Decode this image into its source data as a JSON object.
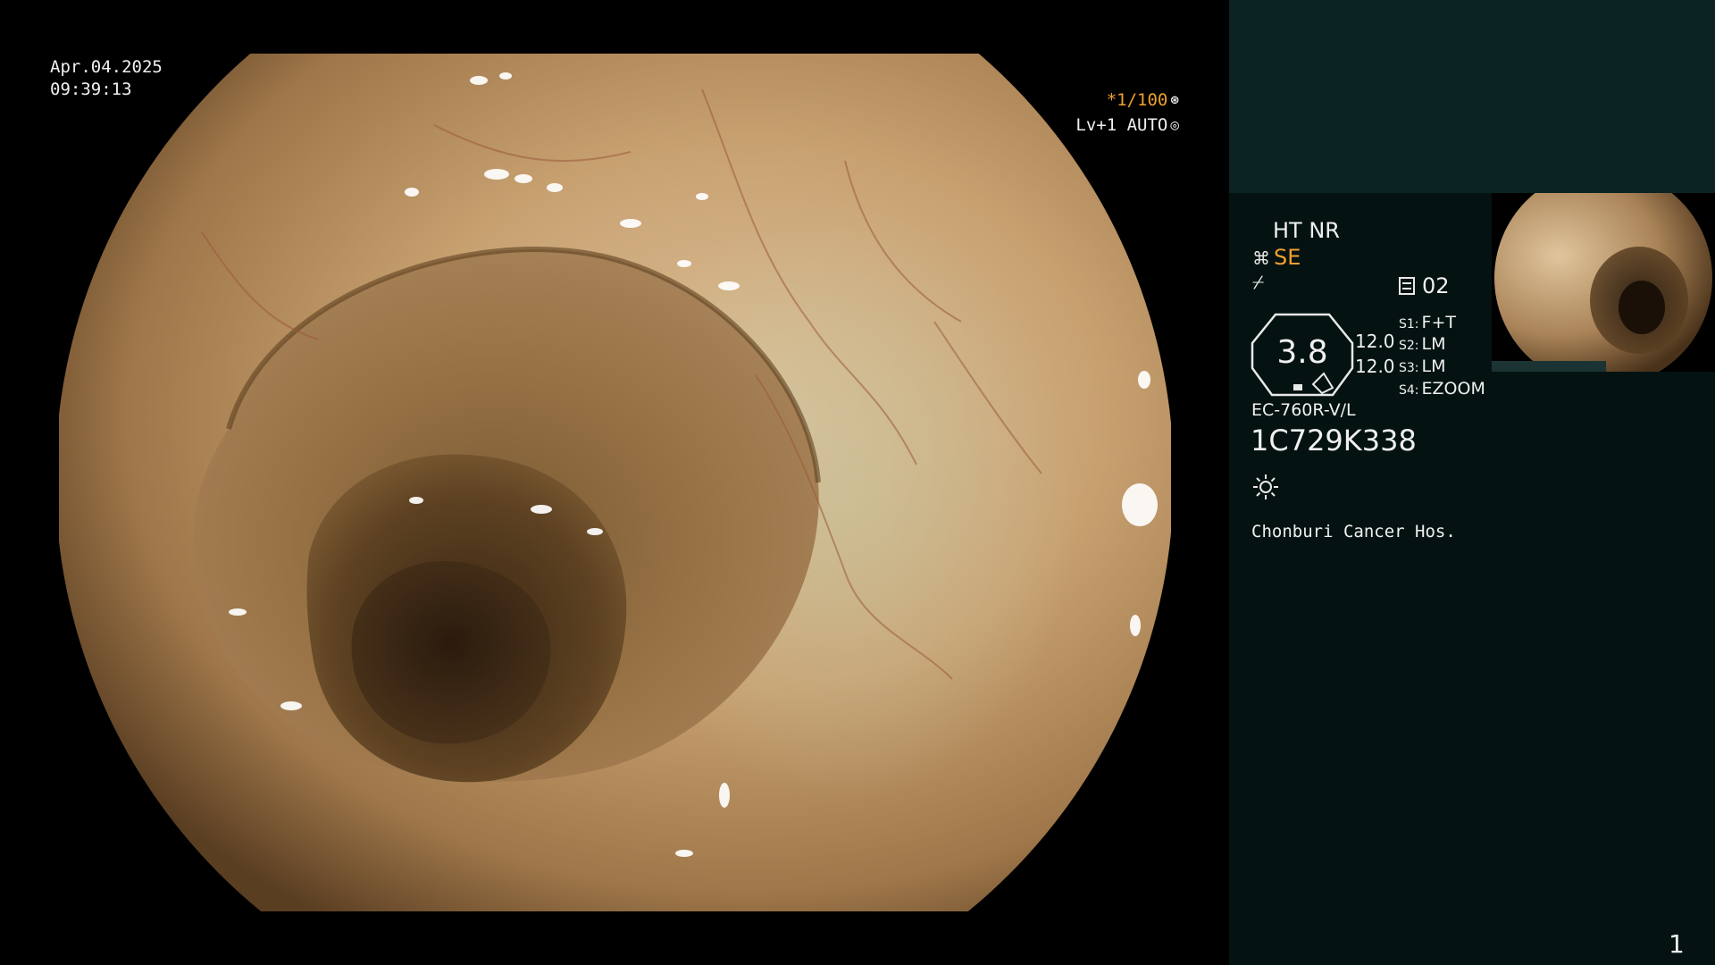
{
  "overlay": {
    "date": "Apr.04.2025",
    "time": "09:39:13",
    "shutter": "*1/100",
    "enhance_level": "Lv+1 AUTO"
  },
  "panel": {
    "ht_nr": "HT NR",
    "se": "SE",
    "memo": "02",
    "zoom": "3.8",
    "value_a": "12.0",
    "value_b": "12.0",
    "switches": [
      {
        "key": "S1:",
        "value": "F+T"
      },
      {
        "key": "S2:",
        "value": "LM"
      },
      {
        "key": "S3:",
        "value": "LM"
      },
      {
        "key": "S4:",
        "value": "EZOOM"
      }
    ],
    "scope_model": "EC-760R-V/L",
    "scope_serial": "1C729K338",
    "hospital": "Chonburi Cancer Hos.",
    "page_number": "1"
  },
  "colors": {
    "mucosa_light": "#d9b98f",
    "mucosa_mid": "#b0885a",
    "lumen_dark": "#2a1a0c",
    "panel_top": "#0b2323",
    "panel_main": "#041212",
    "accent_orange": "#f0a030"
  },
  "icons": {
    "shutter_glyph": "⊛",
    "auto_glyph": "◎",
    "se_glyph": "⌘",
    "af_glyph": "⌿"
  }
}
